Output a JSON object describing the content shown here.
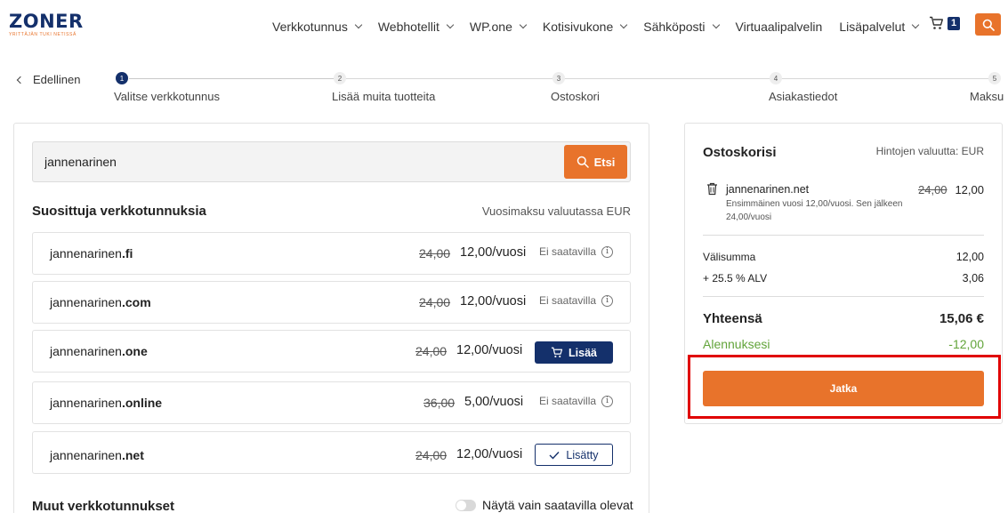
{
  "brand": {
    "name": "ZONER",
    "tagline": "YRITTÄJÄN TUKI NETISSÄ",
    "primary_color": "#14306b",
    "accent_color": "#e8732b"
  },
  "nav": {
    "items": [
      {
        "label": "Verkkotunnus",
        "dropdown": true
      },
      {
        "label": "Webhotellit",
        "dropdown": true
      },
      {
        "label": "WP.one",
        "dropdown": true
      },
      {
        "label": "Kotisivukone",
        "dropdown": true
      },
      {
        "label": "Sähköposti",
        "dropdown": true
      },
      {
        "label": "Virtuaalipalvelin",
        "dropdown": false
      },
      {
        "label": "Lisäpalvelut",
        "dropdown": true
      }
    ],
    "cart_icon": "cart-icon",
    "cart_count": "1",
    "search_icon": "search-icon"
  },
  "stepper": {
    "back_label": "Edellinen",
    "steps": [
      {
        "number": "1",
        "label": "Valitse verkkotunnus",
        "active": true
      },
      {
        "number": "2",
        "label": "Lisää muita tuotteita",
        "active": false
      },
      {
        "number": "3",
        "label": "Ostoskori",
        "active": false
      },
      {
        "number": "4",
        "label": "Asiakastiedot",
        "active": false
      },
      {
        "number": "5",
        "label": "Maksu",
        "active": false
      }
    ]
  },
  "search": {
    "value": "jannenarinen",
    "button_label": "Etsi"
  },
  "suggested": {
    "title": "Suosittuja verkkotunnuksia",
    "currency_note": "Vuosimaksu valuutassa EUR",
    "domains": [
      {
        "name": "jannenarinen",
        "tld": ".fi",
        "old_price": "24,00",
        "price": "12,00/vuosi",
        "status": "Ei saatavilla",
        "action": null
      },
      {
        "name": "jannenarinen",
        "tld": ".com",
        "old_price": "24,00",
        "price": "12,00/vuosi",
        "status": "Ei saatavilla",
        "action": null
      },
      {
        "name": "jannenarinen",
        "tld": ".one",
        "old_price": "24,00",
        "price": "12,00/vuosi",
        "status": null,
        "action": "Lisää"
      },
      {
        "name": "jannenarinen",
        "tld": ".online",
        "old_price": "36,00",
        "price": "5,00/vuosi",
        "status": "Ei saatavilla",
        "action": null
      },
      {
        "name": "jannenarinen",
        "tld": ".net",
        "old_price": "24,00",
        "price": "12,00/vuosi",
        "status": null,
        "action": "Lisätty"
      }
    ]
  },
  "other": {
    "title": "Muut verkkotunnukset",
    "toggle_label": "Näytä vain saatavilla olevat",
    "toggle_on": false
  },
  "cart": {
    "title": "Ostoskorisi",
    "currency": "Hintojen valuutta: EUR",
    "item": {
      "name": "jannenarinen.net",
      "description": "Ensimmäinen vuosi 12,00/vuosi. Sen jälkeen 24,00/vuosi",
      "old_price": "24,00",
      "price": "12,00"
    },
    "subtotal_label": "Välisumma",
    "subtotal_value": "12,00",
    "vat_label": "+ 25.5 % ALV",
    "vat_value": "3,06",
    "total_label": "Yhteensä",
    "total_value": "15,06 €",
    "discount_label": "Alennuksesi",
    "discount_value": "-12,00",
    "discount_color": "#62a43a",
    "continue_label": "Jatka"
  },
  "highlight_color": "#e00000"
}
